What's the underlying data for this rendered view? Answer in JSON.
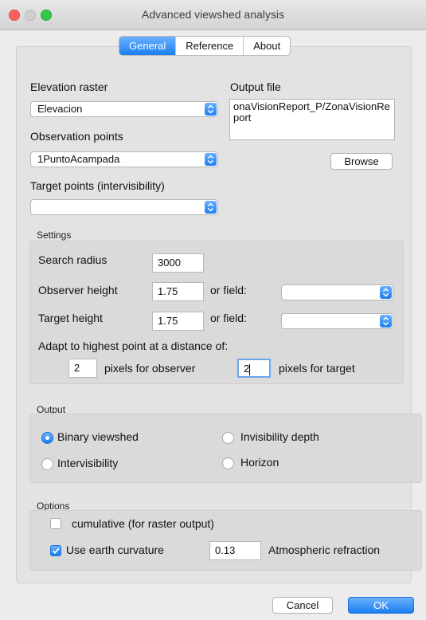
{
  "window": {
    "title": "Advanced viewshed analysis"
  },
  "tabs": [
    "General",
    "Reference",
    "About"
  ],
  "general": {
    "elevation_label": "Elevation raster",
    "elevation_value": "Elevacion",
    "observation_label": "Observation points",
    "observation_value": "1PuntoAcampada",
    "target_label": "Target points (intervisibility)",
    "target_value": "",
    "output_label": "Output file",
    "output_value": "onaVisionReport_P/ZonaVisionReport",
    "browse_label": "Browse"
  },
  "settings": {
    "group_title": "Settings",
    "search_radius_label": "Search radius",
    "search_radius_value": "3000",
    "observer_height_label": "Observer height",
    "observer_height_value": "1.75",
    "or_field_label": "or field:",
    "target_height_label": "Target height",
    "target_height_value": "1.75",
    "adapt_label": "Adapt to highest point at a distance of:",
    "observer_pixels_value": "2",
    "observer_pixels_label": "pixels for observer",
    "target_pixels_value": "2",
    "target_pixels_label": "pixels for target"
  },
  "output": {
    "group_title": "Output",
    "binary": "Binary viewshed",
    "invisibility": "Invisibility depth",
    "intervisibility": "Intervisibility",
    "horizon": "Horizon",
    "selected": "Binary viewshed"
  },
  "options": {
    "group_title": "Options",
    "cumulative_label": "cumulative (for raster output)",
    "cumulative_checked": false,
    "curvature_label": "Use earth curvature",
    "curvature_checked": true,
    "refraction_value": "0.13",
    "refraction_label": "Atmospheric refraction"
  },
  "buttons": {
    "cancel": "Cancel",
    "ok": "OK"
  },
  "colors": {
    "accent": "#1c7ff0",
    "close": "#fc605c",
    "minimize": "#c9c9c9",
    "zoom": "#34c84a"
  }
}
